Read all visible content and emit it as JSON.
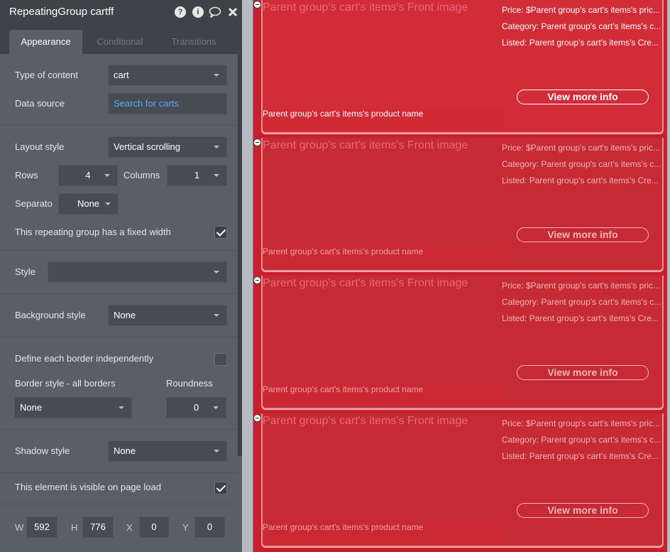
{
  "panel": {
    "title": "RepeatingGroup cartff",
    "icons": [
      "help-icon",
      "info-icon",
      "comment-icon",
      "close-icon"
    ],
    "tabs": [
      {
        "label": "Appearance",
        "active": true
      },
      {
        "label": "Conditional",
        "active": false
      },
      {
        "label": "Transitions",
        "active": false
      }
    ],
    "type_of_content": {
      "label": "Type of content",
      "value": "cart"
    },
    "data_source": {
      "label": "Data source",
      "value": "Search for carts"
    },
    "layout_style": {
      "label": "Layout style",
      "value": "Vertical scrolling"
    },
    "rows": {
      "label": "Rows",
      "value": "4"
    },
    "columns": {
      "label": "Columns",
      "value": "1"
    },
    "separator": {
      "label": "Separato",
      "value": "None"
    },
    "fixed_width": {
      "label": "This repeating group has a fixed width",
      "checked": true
    },
    "style": {
      "label": "Style",
      "value": ""
    },
    "background_style": {
      "label": "Background style",
      "value": "None"
    },
    "border_independent": {
      "label": "Define each border independently",
      "checked": false
    },
    "border_style": {
      "label": "Border style - all borders",
      "value": "None"
    },
    "roundness": {
      "label": "Roundness",
      "value": "0"
    },
    "shadow_style": {
      "label": "Shadow style",
      "value": "None"
    },
    "visible_on_load": {
      "label": "This element is visible on page load",
      "checked": true
    },
    "geometry": {
      "w_label": "W",
      "w": "592",
      "h_label": "H",
      "h": "776",
      "x_label": "X",
      "x": "0",
      "y_label": "Y",
      "y": "0"
    }
  },
  "cells": [
    {
      "image": "Parent group's cart's items's Front image",
      "price": "Price: $Parent group's cart's items's pric...",
      "category": "Category: Parent group's cart's items's c...",
      "listed": "Listed: Parent group's cart's items's Cre...",
      "button": "View more info",
      "product_name": "Parent group's cart's items's product name"
    },
    {
      "image": "Parent group's cart's items's Front image",
      "price": "Price: $Parent group's cart's items's pric...",
      "category": "Category: Parent group's cart's items's c...",
      "listed": "Listed: Parent group's cart's items's Cre...",
      "button": "View more info",
      "product_name": "Parent group's cart's items's product name"
    },
    {
      "image": "Parent group's cart's items's Front image",
      "price": "Price: $Parent group's cart's items's pric...",
      "category": "Category: Parent group's cart's items's c...",
      "listed": "Listed: Parent group's cart's items's Cre...",
      "button": "View more info",
      "product_name": "Parent group's cart's items's product name"
    },
    {
      "image": "Parent group's cart's items's Front image",
      "price": "Price: $Parent group's cart's items's pric...",
      "category": "Category: Parent group's cart's items's c...",
      "listed": "Listed: Parent group's cart's items's Cre...",
      "button": "View more info",
      "product_name": "Parent group's cart's items's product name"
    }
  ],
  "colors": {
    "panel_bg": "#5a5f65",
    "panel_header": "#3e4348",
    "link": "#5aa8ff",
    "cell_red": "#c62a34"
  }
}
